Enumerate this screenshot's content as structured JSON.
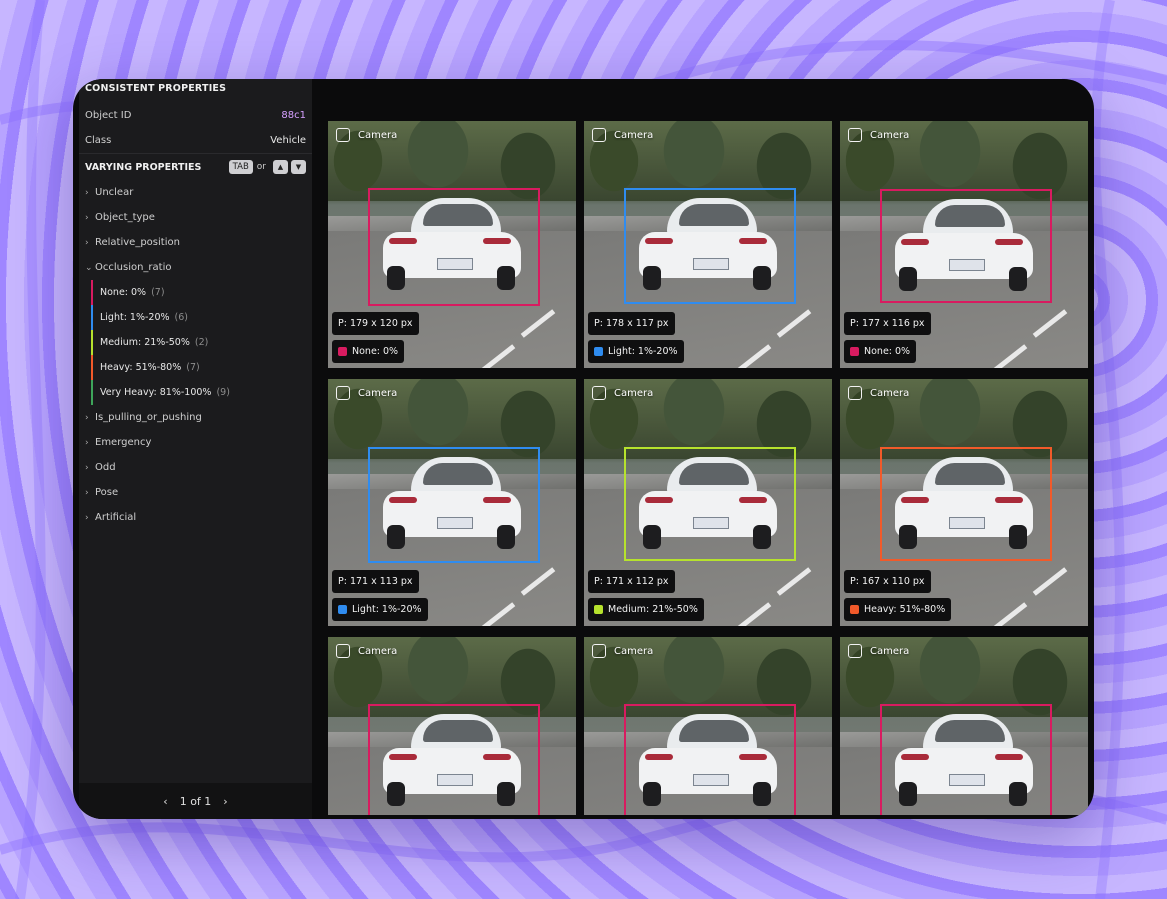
{
  "panel": {
    "consistent_title": "CONSISTENT PROPERTIES",
    "object_id_label": "Object ID",
    "object_id_value": "88c1",
    "class_label": "Class",
    "class_value": "Vehicle",
    "varying_title": "VARYING PROPERTIES",
    "tab_key": "TAB",
    "or_text": "or",
    "properties": [
      {
        "label": "Unclear"
      },
      {
        "label": "Object_type"
      },
      {
        "label": "Relative_position"
      },
      {
        "label": "Occlusion_ratio",
        "expanded": true
      },
      {
        "label": "Is_pulling_or_pushing"
      },
      {
        "label": "Emergency"
      },
      {
        "label": "Odd"
      },
      {
        "label": "Pose"
      },
      {
        "label": "Artificial"
      }
    ],
    "occlusion_values": [
      {
        "label": "None: 0%",
        "count": "(7)",
        "color": "#d81b60"
      },
      {
        "label": "Light: 1%-20%",
        "count": "(6)",
        "color": "#2f8cf0"
      },
      {
        "label": "Medium: 21%-50%",
        "count": "(2)",
        "color": "#b6e22d"
      },
      {
        "label": "Heavy: 51%-80%",
        "count": "(7)",
        "color": "#f25a2a"
      },
      {
        "label": "Very Heavy: 81%-100%",
        "count": "(9)",
        "color": "#3ea55a"
      }
    ],
    "pager": "1 of 1"
  },
  "tiles": [
    {
      "camera": "Camera",
      "size": "P: 179 x 120 px",
      "value": "None: 0%",
      "color": "#d81b60"
    },
    {
      "camera": "Camera",
      "size": "P: 178 x 117 px",
      "value": "Light: 1%-20%",
      "color": "#2f8cf0"
    },
    {
      "camera": "Camera",
      "size": "P: 177 x 116 px",
      "value": "None: 0%",
      "color": "#d81b60"
    },
    {
      "camera": "Camera",
      "size": "P: 171 x 113 px",
      "value": "Light: 1%-20%",
      "color": "#2f8cf0"
    },
    {
      "camera": "Camera",
      "size": "P: 171 x 112 px",
      "value": "Medium: 21%-50%",
      "color": "#b6e22d"
    },
    {
      "camera": "Camera",
      "size": "P: 167 x 110 px",
      "value": "Heavy: 51%-80%",
      "color": "#f25a2a"
    },
    {
      "camera": "Camera",
      "size": "",
      "value": "",
      "color": "#d81b60"
    },
    {
      "camera": "Camera",
      "size": "",
      "value": "",
      "color": "#d81b60"
    },
    {
      "camera": "Camera",
      "size": "",
      "value": "",
      "color": "#d81b60"
    }
  ]
}
